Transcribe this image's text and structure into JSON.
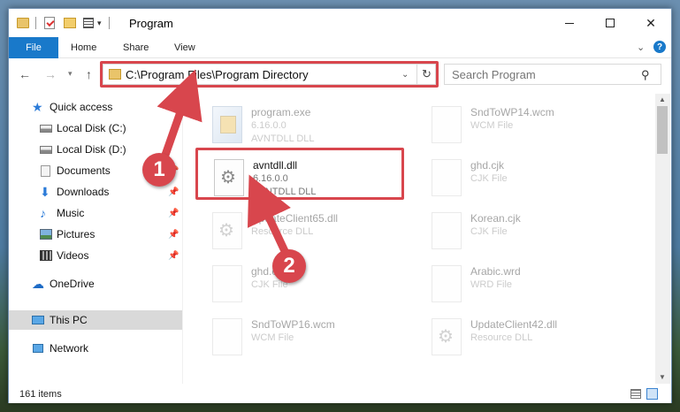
{
  "window": {
    "title": "Program",
    "controls": {
      "minimize": "minimize",
      "maximize": "maximize",
      "close": "✕"
    }
  },
  "ribbon": {
    "tabs": [
      "File",
      "Home",
      "Share",
      "View"
    ],
    "help": "?"
  },
  "nav": {
    "back": "←",
    "forward": "→",
    "up": "↑",
    "address": "C:\\Program Files\\Program Directory",
    "search_placeholder": "Search Program"
  },
  "sidebar": {
    "items": [
      {
        "label": "Quick access",
        "icon": "star-icon",
        "pinned": false
      },
      {
        "label": "Local Disk (C:)",
        "icon": "disk-icon",
        "pinned": false
      },
      {
        "label": "Local Disk (D:)",
        "icon": "disk-icon",
        "pinned": false
      },
      {
        "label": "Documents",
        "icon": "documents-icon",
        "pinned": true
      },
      {
        "label": "Downloads",
        "icon": "download-icon",
        "pinned": true
      },
      {
        "label": "Music",
        "icon": "music-icon",
        "pinned": true
      },
      {
        "label": "Pictures",
        "icon": "pictures-icon",
        "pinned": true
      },
      {
        "label": "Videos",
        "icon": "video-icon",
        "pinned": true
      },
      {
        "label": "OneDrive",
        "icon": "cloud-icon",
        "pinned": false
      },
      {
        "label": "This PC",
        "icon": "pc-icon",
        "pinned": false,
        "selected": true
      },
      {
        "label": "Network",
        "icon": "network-icon",
        "pinned": false
      }
    ]
  },
  "files": [
    {
      "name": "program.exe",
      "version": "6.16.0.0",
      "type": "AVNTDLL DLL",
      "icon": "exe-icon",
      "faded": true
    },
    {
      "name": "SndToWP14.wcm",
      "version": "",
      "type": "WCM File",
      "icon": "file-icon",
      "faded": true
    },
    {
      "name": "avntdll.dll",
      "version": "6.16.0.0",
      "type": "AVNTDLL DLL",
      "icon": "dll-icon",
      "faded": false,
      "highlighted": true
    },
    {
      "name": "ghd.cjk",
      "version": "",
      "type": "CJK File",
      "icon": "file-icon",
      "faded": true
    },
    {
      "name": "UpdateClient65.dll",
      "version": "",
      "type": "Resource DLL",
      "icon": "dll-icon",
      "faded": true
    },
    {
      "name": "Korean.cjk",
      "version": "",
      "type": "CJK File",
      "icon": "file-icon",
      "faded": true
    },
    {
      "name": "ghd.cjk",
      "version": "",
      "type": "CJK File",
      "icon": "file-icon",
      "faded": true
    },
    {
      "name": "Arabic.wrd",
      "version": "",
      "type": "WRD File",
      "icon": "file-icon",
      "faded": true
    },
    {
      "name": "SndToWP16.wcm",
      "version": "",
      "type": "WCM File",
      "icon": "file-icon",
      "faded": true
    },
    {
      "name": "UpdateClient42.dll",
      "version": "",
      "type": "Resource DLL",
      "icon": "dll-icon",
      "faded": true
    }
  ],
  "status": {
    "count": "161 items"
  },
  "callouts": [
    "1",
    "2"
  ],
  "colors": {
    "accent": "#1979ca",
    "highlight": "#d8464d"
  }
}
